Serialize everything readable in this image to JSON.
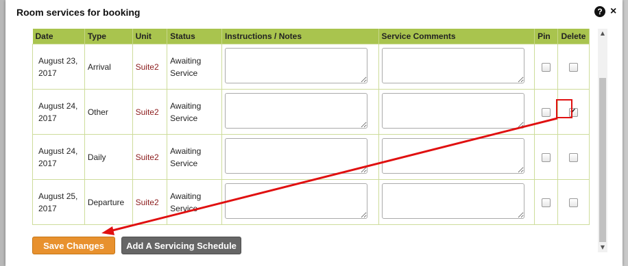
{
  "dialog": {
    "title": "Room services for booking",
    "help_icon_glyph": "?",
    "close_icon_glyph": "×"
  },
  "table": {
    "columns": [
      "Date",
      "Type",
      "Unit",
      "Status",
      "Instructions / Notes",
      "Service Comments",
      "Pin",
      "Delete"
    ],
    "rows": [
      {
        "date_line1": "August 23,",
        "date_line2": "2017",
        "type": "Arrival",
        "unit": "Suite2",
        "status_line1": "Awaiting",
        "status_line2": "Service",
        "instructions": "",
        "comments": "",
        "pin": false,
        "delete": false
      },
      {
        "date_line1": "August 24,",
        "date_line2": "2017",
        "type": "Other",
        "unit": "Suite2",
        "status_line1": "Awaiting",
        "status_line2": "Service",
        "instructions": "",
        "comments": "",
        "pin": false,
        "delete": true
      },
      {
        "date_line1": "August 24,",
        "date_line2": "2017",
        "type": "Daily",
        "unit": "Suite2",
        "status_line1": "Awaiting",
        "status_line2": "Service",
        "instructions": "",
        "comments": "",
        "pin": false,
        "delete": false
      },
      {
        "date_line1": "August 25,",
        "date_line2": "2017",
        "type": "Departure",
        "unit": "Suite2",
        "status_line1": "Awaiting",
        "status_line2": "Service",
        "instructions": "",
        "comments": "",
        "pin": false,
        "delete": false
      }
    ]
  },
  "buttons": {
    "save_label": "Save Changes",
    "schedule_label": "Add A Servicing Schedule"
  },
  "colors": {
    "header_bg": "#a9c44e",
    "unit_text": "#8b1a1a",
    "save_button": "#e8912e",
    "schedule_button": "#666666",
    "annotation_red": "#e01010"
  },
  "icons": {
    "help": "help-icon",
    "close": "close-icon",
    "scroll_up": "scroll-up-arrow-icon",
    "scroll_down": "scroll-down-arrow-icon",
    "checkmark": "checkmark-icon"
  }
}
